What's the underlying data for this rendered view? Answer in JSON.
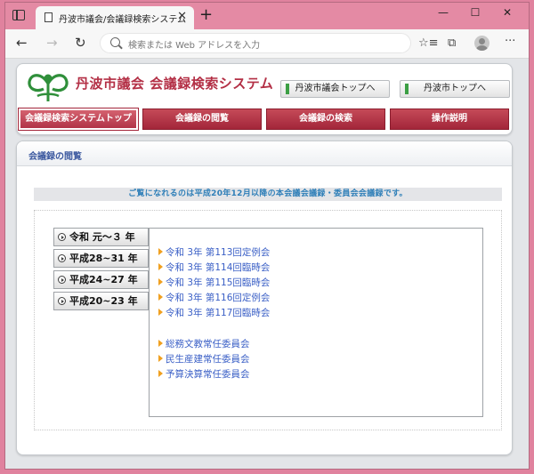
{
  "browser": {
    "tab_title": "丹波市議会/会議録検索システム",
    "tab_close": "✕",
    "new_tab": "+",
    "win_min": "—",
    "win_max": "☐",
    "win_close": "✕",
    "back": "←",
    "forward": "→",
    "reload": "↻",
    "address_placeholder": "検索または Web アドレスを入力",
    "favorites_icon": "☆≡",
    "collections_icon": "⧉",
    "more_icon": "···"
  },
  "header": {
    "title": "丹波市議会  会議録検索システム",
    "links": [
      "丹波市議会トップへ",
      "丹波市トップへ"
    ]
  },
  "nav": {
    "items": [
      "会議録検索システムトップ",
      "会議録の閲覧",
      "会議録の検索",
      "操作説明"
    ],
    "active_index": 0
  },
  "section": {
    "title": "会議録の閲覧",
    "notice": "ご覧になれるのは平成20年12月以降の本会議会議録・委員会会議録です。"
  },
  "eras": [
    "令和 元～３ 年",
    "平成28~31 年",
    "平成24~27 年",
    "平成20~23 年"
  ],
  "sessions": [
    "令和 3年 第113回定例会",
    "令和 3年 第114回臨時会",
    "令和 3年 第115回臨時会",
    "令和 3年 第116回定例会",
    "令和 3年 第117回臨時会"
  ],
  "committees": [
    "総務文教常任委員会",
    "民生産建常任委員会",
    "予算決算常任委員会"
  ],
  "colors": {
    "accent_red": "#b32f45",
    "nav_red": "#a3263a",
    "link_blue": "#3a5fc6",
    "notice_blue": "#2f7fb8",
    "logo_green": "#2f8f3a"
  }
}
